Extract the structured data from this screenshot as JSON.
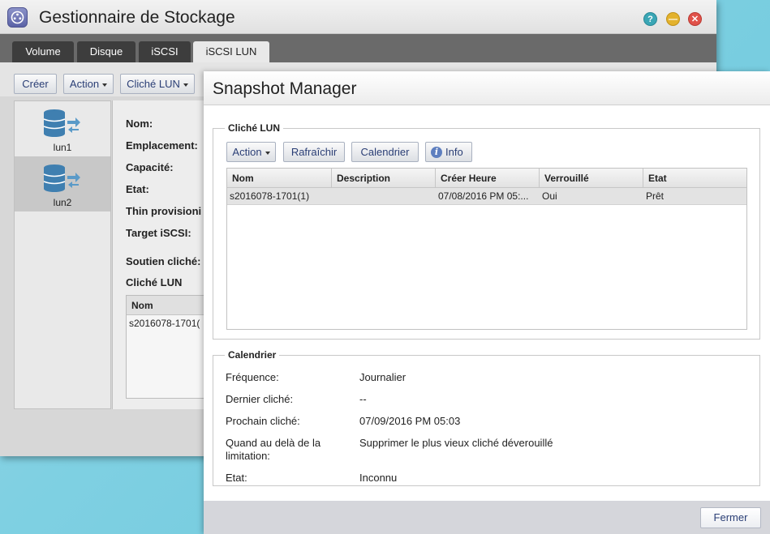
{
  "storage_manager": {
    "title": "Gestionnaire de Stockage",
    "window_buttons": {
      "help": "?",
      "minimize": "—",
      "close": "✕"
    },
    "tabs": [
      {
        "label": "Volume"
      },
      {
        "label": "Disque"
      },
      {
        "label": "iSCSI"
      },
      {
        "label": "iSCSI LUN",
        "active": true
      }
    ],
    "toolbar": {
      "create": "Créer",
      "action": "Action",
      "snapshot_lun": "Cliché LUN"
    },
    "luns": [
      {
        "label": "lun1"
      },
      {
        "label": "lun2",
        "selected": true
      }
    ],
    "details": {
      "name_label": "Nom:",
      "location_label": "Emplacement:",
      "capacity_label": "Capacité:",
      "state_label": "Etat:",
      "thin_label": "Thin provisioni",
      "target_label": "Target iSCSI:",
      "snapshot_support_label": "Soutien cliché:",
      "snapshot_lun_label": "Cliché LUN",
      "grid_header": "Nom",
      "grid_row": "s2016078-1701("
    }
  },
  "snapshot_manager": {
    "title": "Snapshot Manager",
    "snapshot_section": {
      "legend": "Cliché LUN",
      "buttons": {
        "action": "Action",
        "refresh": "Rafraîchir",
        "calendar": "Calendrier",
        "info": "Info"
      },
      "columns": [
        "Nom",
        "Description",
        "Créer Heure",
        "Verrouillé",
        "Etat"
      ],
      "rows": [
        {
          "name": "s2016078-1701(1)",
          "description": "",
          "created": "07/08/2016 PM 05:...",
          "locked": "Oui",
          "state": "Prêt"
        }
      ]
    },
    "calendar_section": {
      "legend": "Calendrier",
      "frequency_label": "Fréquence:",
      "frequency_value": "Journalier",
      "last_label": "Dernier cliché:",
      "last_value": "--",
      "next_label": "Prochain cliché:",
      "next_value": "07/09/2016 PM 05:03",
      "limit_label_1": "Quand au delà de la",
      "limit_label_2": "limitation:",
      "limit_value": "Supprimer le plus vieux cliché déverouillé",
      "state_label": "Etat:",
      "state_value": "Inconnu"
    },
    "close_button": "Fermer"
  }
}
